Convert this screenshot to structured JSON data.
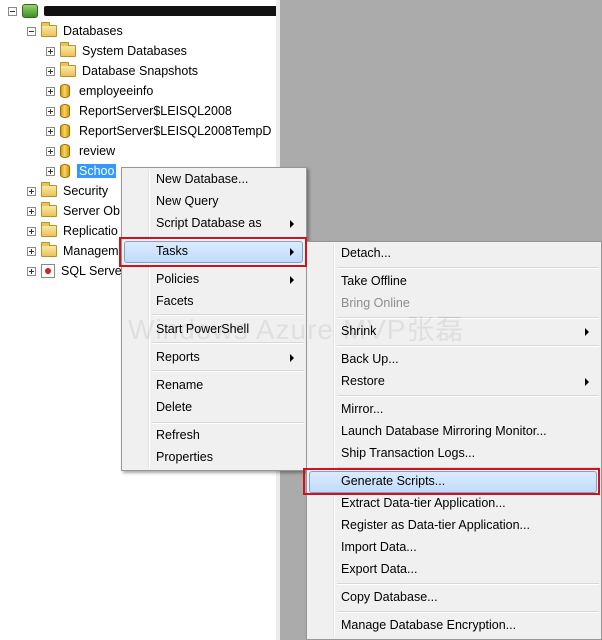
{
  "tree": {
    "server_label_redacted": true,
    "nodes": [
      {
        "label": "Databases"
      },
      {
        "label": "System Databases"
      },
      {
        "label": "Database Snapshots"
      },
      {
        "label": "employeeinfo"
      },
      {
        "label": "ReportServer$LEISQL2008"
      },
      {
        "label": "ReportServer$LEISQL2008TempD"
      },
      {
        "label": "review"
      },
      {
        "label": "Schoo"
      },
      {
        "label": "Security"
      },
      {
        "label": "Server Ob"
      },
      {
        "label": "Replicatio"
      },
      {
        "label": "Managem"
      },
      {
        "label": "SQL Serve"
      }
    ],
    "selected": "Schoo"
  },
  "context_menu": {
    "items": [
      {
        "label": "New Database..."
      },
      {
        "label": "New Query"
      },
      {
        "label": "Script Database as",
        "submenu": true
      },
      {
        "label": "Tasks",
        "submenu": true,
        "highlighted": true
      },
      {
        "label": "Policies",
        "submenu": true
      },
      {
        "label": "Facets"
      },
      {
        "label": "Start PowerShell"
      },
      {
        "label": "Reports",
        "submenu": true
      },
      {
        "label": "Rename"
      },
      {
        "label": "Delete"
      },
      {
        "label": "Refresh"
      },
      {
        "label": "Properties"
      }
    ]
  },
  "tasks_submenu": {
    "items": [
      {
        "label": "Detach..."
      },
      {
        "label": "Take Offline"
      },
      {
        "label": "Bring Online",
        "disabled": true
      },
      {
        "label": "Shrink",
        "submenu": true
      },
      {
        "label": "Back Up..."
      },
      {
        "label": "Restore",
        "submenu": true
      },
      {
        "label": "Mirror..."
      },
      {
        "label": "Launch Database Mirroring Monitor..."
      },
      {
        "label": "Ship Transaction Logs..."
      },
      {
        "label": "Generate Scripts...",
        "highlighted": true
      },
      {
        "label": "Extract Data-tier Application..."
      },
      {
        "label": "Register as Data-tier Application..."
      },
      {
        "label": "Import Data..."
      },
      {
        "label": "Export Data..."
      },
      {
        "label": "Copy Database..."
      },
      {
        "label": "Manage Database Encryption..."
      }
    ]
  },
  "watermark": "Windows Azure MVP张磊",
  "colors": {
    "highlight_border": "#d1121b",
    "selection": "#3399ff",
    "background_gray": "#ababab"
  }
}
